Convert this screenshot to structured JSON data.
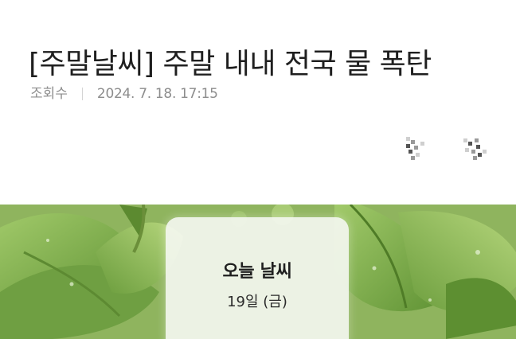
{
  "article": {
    "title": "[주말날씨] 주말 내내 전국 물 폭탄",
    "views_label": "조회수",
    "datetime": "2024. 7. 18. 17:15"
  },
  "share_tools": [
    {
      "icon": "font-size-icon"
    },
    {
      "icon": "share-icon"
    }
  ],
  "weather_card": {
    "title": "오늘 날씨",
    "day": "19일 (금)"
  },
  "colors": {
    "title": "#1f1f1f",
    "meta": "#8d8d8d",
    "leaf": "#7aa84a"
  }
}
